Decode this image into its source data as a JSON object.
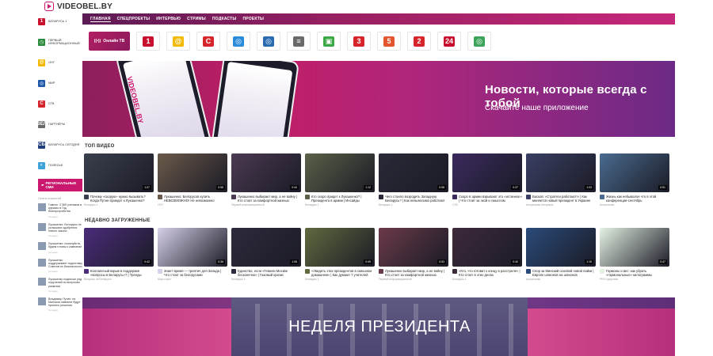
{
  "site": {
    "logo_text": "VIDEOBEL.BY"
  },
  "nav": {
    "items": [
      "ГЛАВНАЯ",
      "СПЕЦПРОЕКТЫ",
      "ИНТЕРВЬЮ",
      "СТРИМЫ",
      "ПОДКАСТЫ",
      "ПРОЕКТЫ"
    ]
  },
  "sidebar": {
    "channels": [
      {
        "label": "БЕЛАРУСЬ 1",
        "icon": "1",
        "color": "#c8102e"
      },
      {
        "label": "ПЕРВЫЙ ИНФОРМАЦИОННЫЙ",
        "icon": "◷",
        "color": "#2a8b3c"
      },
      {
        "label": "ОНТ",
        "icon": "@",
        "color": "#f2b900"
      },
      {
        "label": "МИР",
        "icon": "◎",
        "color": "#1d58a8"
      },
      {
        "label": "СТВ",
        "icon": "С",
        "color": "#d6252a"
      },
      {
        "label": "ПАРТНЁРЫ",
        "icon": "ВЕЛ",
        "color": "#6a6a6a"
      },
      {
        "label": "БЕЛАРУСЬ СЕГОДНЯ",
        "icon": "СБ",
        "color": "#1f3d7a"
      },
      {
        "label": "ПОЛЕСЬЕ",
        "icon": "◐",
        "color": "#3ea3d9"
      }
    ],
    "regional": "РЕГИОНАЛЬНЫЕ СМИ",
    "feed_title": "Лента новостей",
    "feed": [
      {
        "text": "Гомель: 3 380 учеников в кружках в Год благоустройства",
        "time": "Сегодня"
      },
      {
        "text": "Лукашенко: Белорусы не услышали одобрения нового закона",
        "time": "Сегодня"
      },
      {
        "text": "Лукашенко: пожалуйста, будем готовы к кампании",
        "time": "Сегодня"
      },
      {
        "text": "Лукашенко поддерживает подготовку Советов по безопасности",
        "time": "Сегодня"
      },
      {
        "text": "Лукашенко подписал ряд поручений по вопросам развития",
        "time": "Сегодня"
      },
      {
        "text": "Владимир Путин: на Минском саммите будут приняты решения",
        "time": "Сегодня"
      }
    ]
  },
  "channels_bar": {
    "tv_button": "Онлайн ТВ",
    "tiles": [
      {
        "icon": "1",
        "color": "#c8102e"
      },
      {
        "icon": "@",
        "color": "#f2b900"
      },
      {
        "icon": "С",
        "color": "#d6252a"
      },
      {
        "icon": "◎",
        "color": "#2a8bd9"
      },
      {
        "icon": "◎",
        "color": "#2a6bb0"
      },
      {
        "icon": "≡",
        "color": "#6a6a6a"
      },
      {
        "icon": "▣",
        "color": "#3aa845"
      },
      {
        "icon": "3",
        "color": "#d6252a"
      },
      {
        "icon": "5",
        "color": "#e4572e"
      },
      {
        "icon": "2",
        "color": "#d6252a"
      },
      {
        "icon": "24",
        "color": "#c8102e"
      },
      {
        "icon": "◎",
        "color": "#3ea35a"
      }
    ]
  },
  "banner": {
    "title": "Новости, которые всегда с тобой",
    "subtitle": "Скачайте наше приложение",
    "app_label": "VIDEOBEL.BY"
  },
  "top_video": {
    "title": "ТОП ВИДЕО",
    "cards": [
      {
        "title": "Почему «скорую» нужно вызывать? Когда Путин приедет к Лукашенко?",
        "meta": "Беларусь 1",
        "color": "#3a3f4d",
        "badge": "1:07"
      },
      {
        "title": "Лукашенко: Белорусов купить НЕВОЗМОЖНО! Не невозможно",
        "meta": "ОНТ",
        "color": "#6b5a4a",
        "badge": "0:55"
      },
      {
        "title": "Лукашенко выбирает мир, а не войну | Кто стоит за комфортной жизнью",
        "meta": "Первый информационный",
        "color": "#4b3a52",
        "badge": "0:44"
      },
      {
        "title": "Кто скоро придет к Лукашенко? | Президента в армии | Инсайды",
        "meta": "Беларусь 1",
        "color": "#5a6148",
        "badge": "1:12"
      },
      {
        "title": "Чего стоило возродить Западную Беларусь? | Как невыносимо работают",
        "meta": "Беларусь 1",
        "color": "#2a2a38",
        "badge": "0:58"
      },
      {
        "title": "Скоро в армии взрывают это «истинное» | Что стоит за экой и смыслом",
        "meta": "СТВ",
        "color": "#3b2a5e",
        "badge": "0:37"
      },
      {
        "title": "Басков: «Стратеги работают!» | Как меняется новый президент в Украине",
        "meta": "Актуальная интервью",
        "color": "#3a3f63",
        "badge": "1:03"
      },
      {
        "title": "Жизнь как небывалое что в этой конференции-сентябрь",
        "meta": "Актуальная",
        "color": "#4a6b8f",
        "badge": "0:51"
      }
    ]
  },
  "recent": {
    "title": "НЕДАВНО ЗАГРУЖЕННЫЕ",
    "cards": [
      {
        "title": "Коллапсный взрыв в поддержке «вопросы в Беларусь»? | Тренды",
        "meta": "Вопросы на Беларуси",
        "color": "#4a2c7a",
        "badge": "0:42"
      },
      {
        "title": "Знает время — триптич для Запада | Что стоит за белорусами",
        "meta": "Мир стран",
        "color": "#d6d0e8",
        "badge": "0:36"
      },
      {
        "title": "Единство, если «Гемели Москве бесконечно» | Газовый кризис",
        "meta": "Беларусь 1",
        "color": "#2e2a3d",
        "badge": "1:08"
      },
      {
        "title": "«Увидеть этих президентов в смешном домашнем» | Как думают 7 учителей",
        "meta": "Беларусь 1",
        "color": "#5f6a3f",
        "badge": "0:49"
      },
      {
        "title": "Лукашенко выбирает мир, а не войну | Кто стоит за комфортной жизнью",
        "meta": "Первый информационный",
        "color": "#6b3a4a",
        "badge": "0:53"
      },
      {
        "title": "«Кто, что готовит к концу в расстреле» | Кто стоит в этих делах",
        "meta": "Беларусь 1",
        "color": "#3d2a3a",
        "badge": "0:40"
      },
      {
        "title": "Спор за Минский основой новой пайки | Европе шпионов на шпионов",
        "meta": "Актуальная",
        "color": "#2a4a7a",
        "badge": "1:15"
      },
      {
        "title": "Гормоны и вес: как убрать «гормональные» килограммы",
        "meta": "PRO Здоровье",
        "color": "#e4f2e4",
        "badge": "0:47"
      }
    ]
  },
  "bottom_banner": {
    "text": "НЕДЕЛЯ ПРЕЗИДЕНТА"
  }
}
